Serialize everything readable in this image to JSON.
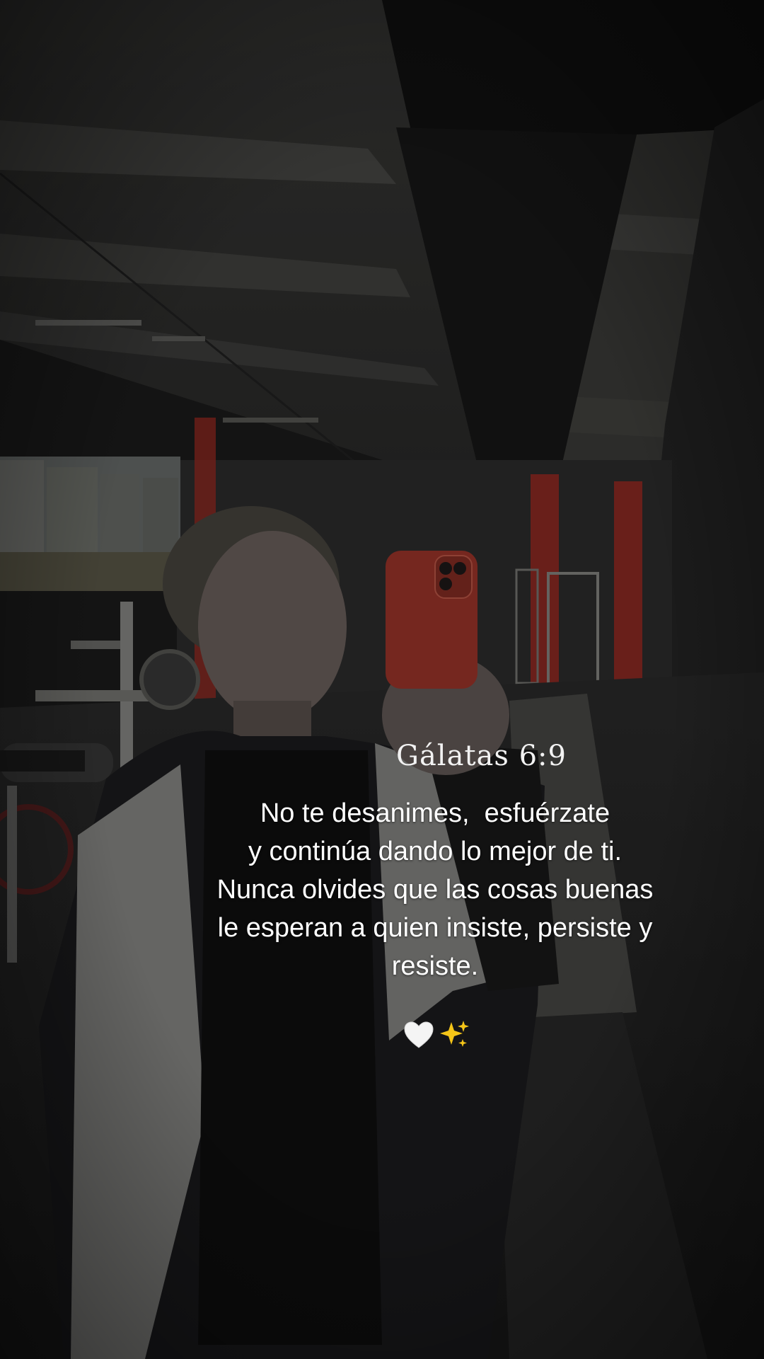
{
  "caption": {
    "reference": "Gálatas 6:9",
    "lines": [
      "No te desanimes,  esfuérzate",
      "y continúa dando lo mejor de ti.",
      "Nunca olvides que las cosas buenas",
      "le esperan a quien insiste, persiste y",
      "resiste."
    ],
    "emojis": [
      "white-heart-icon",
      "sparkles-icon"
    ]
  },
  "colors": {
    "phone_case": "#c0392b",
    "gym_accent_red": "#b3261e",
    "text": "#ffffff"
  }
}
